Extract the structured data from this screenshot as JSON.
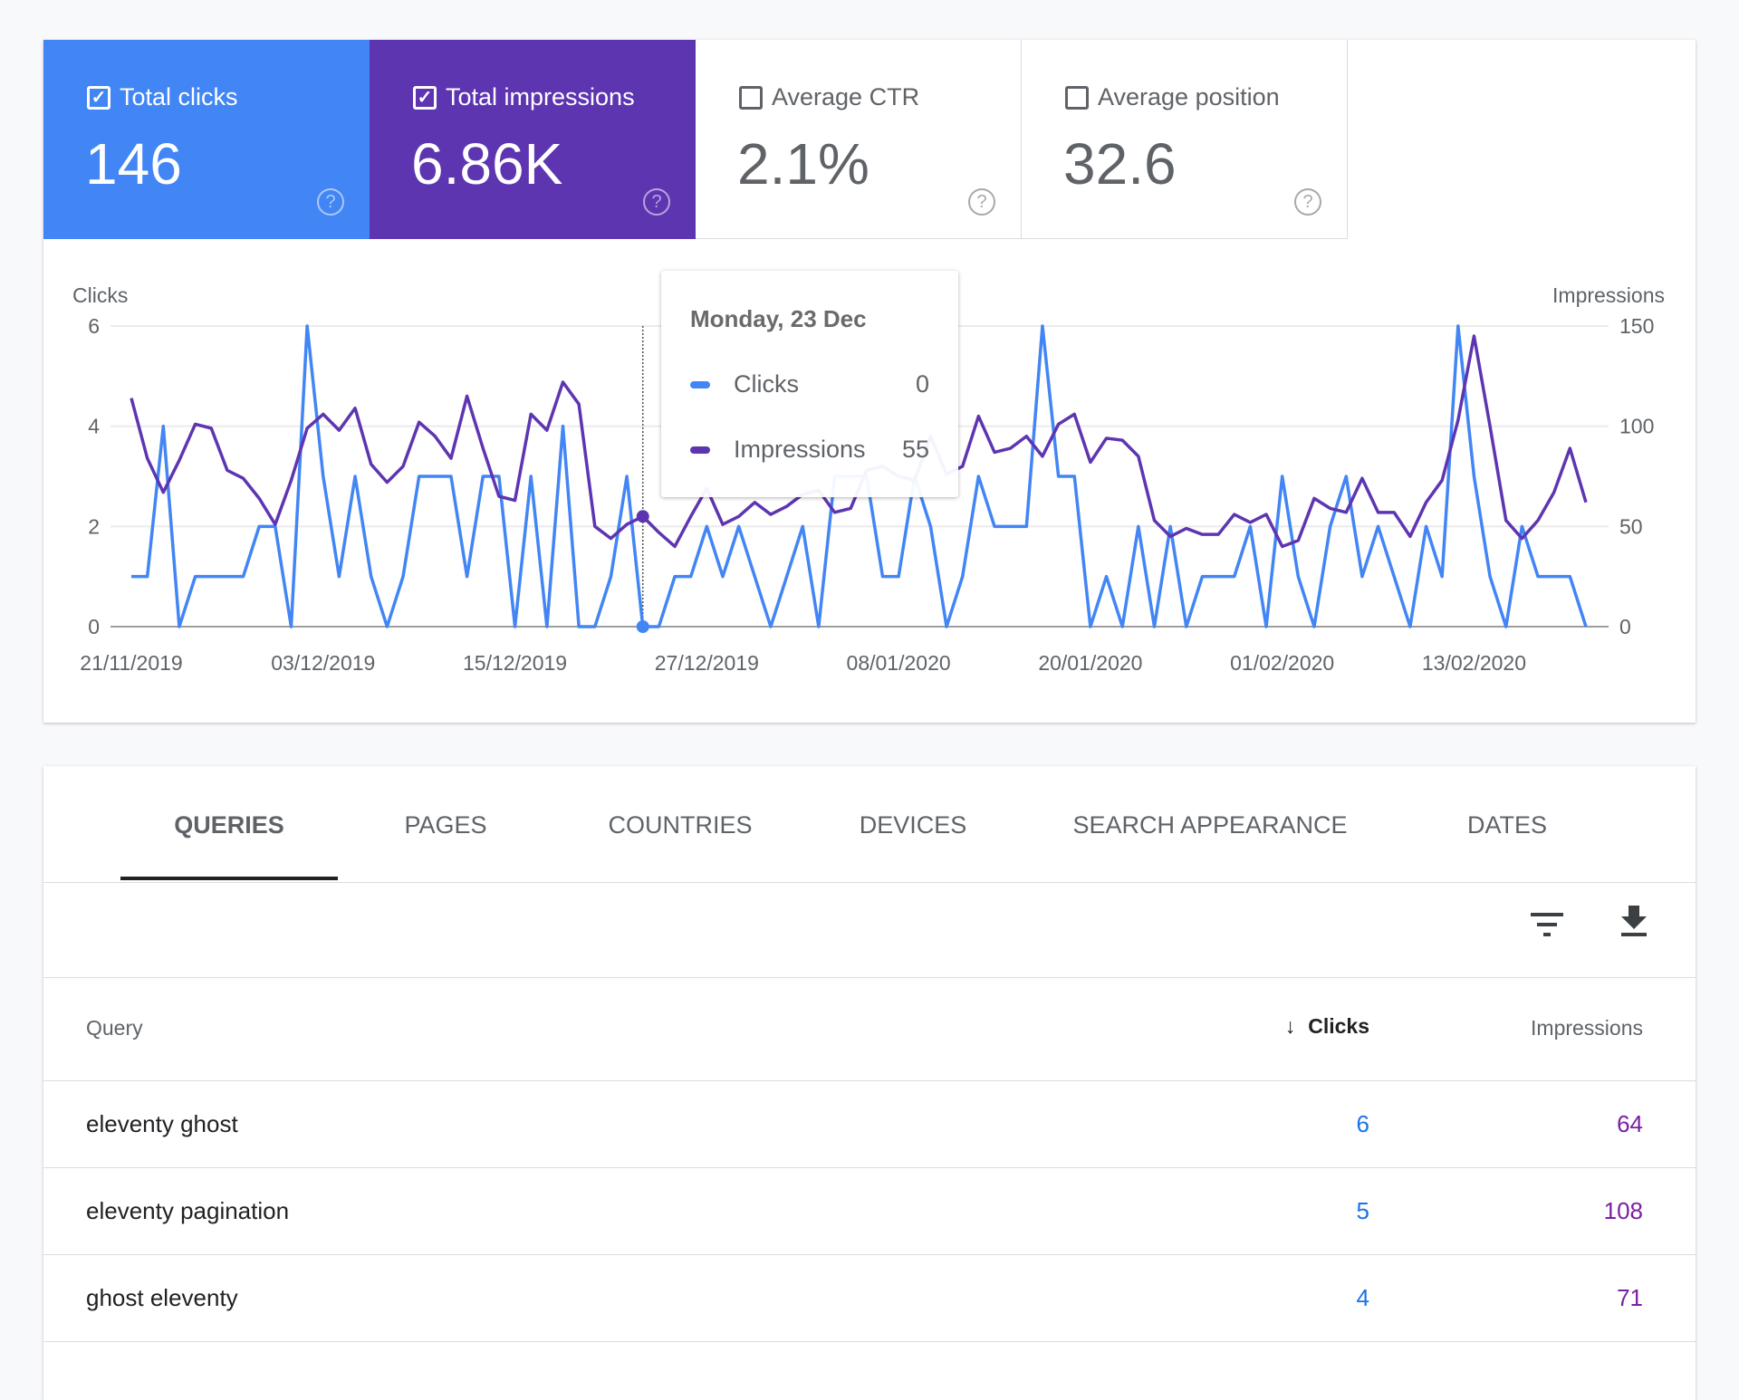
{
  "colors": {
    "clicks": "#4285f4",
    "impressions": "#5e35b1"
  },
  "kpis": [
    {
      "label": "Total clicks",
      "value": "146",
      "checked": true,
      "help_icon": "help-circle-icon"
    },
    {
      "label": "Total impressions",
      "value": "6.86K",
      "checked": true,
      "help_icon": "help-circle-icon"
    },
    {
      "label": "Average CTR",
      "value": "2.1%",
      "checked": false,
      "help_icon": "help-circle-icon"
    },
    {
      "label": "Average position",
      "value": "32.6",
      "checked": false,
      "help_icon": "help-circle-icon"
    }
  ],
  "tooltip": {
    "date": "Monday, 23 Dec",
    "rows": [
      {
        "label": "Clicks",
        "value": "0"
      },
      {
        "label": "Impressions",
        "value": "55"
      }
    ]
  },
  "chart_data": {
    "type": "line",
    "left_axis_label": "Clicks",
    "right_axis_label": "Impressions",
    "left_ylim": [
      0,
      6
    ],
    "right_ylim": [
      0,
      150
    ],
    "left_ticks": [
      "0",
      "2",
      "4",
      "6"
    ],
    "right_ticks": [
      "0",
      "50",
      "100",
      "150"
    ],
    "x_start": "21/11/2019",
    "x_end": "20/02/2020",
    "x_ticks": [
      "21/11/2019",
      "03/12/2019",
      "15/12/2019",
      "27/12/2019",
      "08/01/2020",
      "20/01/2020",
      "01/02/2020",
      "13/02/2020"
    ],
    "grid": true,
    "highlighted": "23/12/2019",
    "series": [
      {
        "name": "Clicks",
        "axis": "left",
        "values": [
          1,
          1,
          4,
          0,
          1,
          1,
          1,
          1,
          2,
          2,
          0,
          6,
          3,
          1,
          3,
          1,
          0,
          1,
          3,
          3,
          3,
          1,
          3,
          3,
          0,
          3,
          0,
          4,
          0,
          0,
          1,
          3,
          0,
          0,
          1,
          1,
          2,
          1,
          2,
          1,
          0,
          1,
          2,
          0,
          3,
          3,
          3,
          1,
          1,
          3,
          2,
          0,
          1,
          3,
          2,
          2,
          2,
          6,
          3,
          3,
          0,
          1,
          0,
          2,
          0,
          2,
          0,
          1,
          1,
          1,
          2,
          0,
          3,
          1,
          0,
          2,
          3,
          1,
          2,
          1,
          0,
          2,
          1,
          6,
          3,
          1,
          0,
          2,
          1,
          1,
          1,
          0
        ]
      },
      {
        "name": "Impressions",
        "axis": "right",
        "values": [
          114,
          84,
          67,
          83,
          101,
          99,
          78,
          74,
          64,
          51,
          73,
          99,
          106,
          98,
          109,
          81,
          72,
          80,
          102,
          95,
          84,
          115,
          89,
          65,
          63,
          106,
          98,
          122,
          111,
          50,
          44,
          51,
          55,
          47,
          40,
          55,
          69,
          51,
          55,
          62,
          56,
          60,
          66,
          68,
          57,
          59,
          78,
          80,
          75,
          73,
          95,
          76,
          80,
          105,
          87,
          89,
          95,
          85,
          101,
          106,
          82,
          94,
          93,
          85,
          53,
          45,
          49,
          46,
          46,
          56,
          52,
          56,
          40,
          43,
          64,
          59,
          57,
          74,
          57,
          57,
          45,
          62,
          73,
          103,
          145,
          100,
          53,
          44,
          53,
          67,
          89,
          62
        ]
      }
    ]
  },
  "tabs": [
    {
      "label": "QUERIES",
      "active": true
    },
    {
      "label": "PAGES"
    },
    {
      "label": "COUNTRIES"
    },
    {
      "label": "DEVICES"
    },
    {
      "label": "SEARCH APPEARANCE"
    },
    {
      "label": "DATES"
    }
  ],
  "toolbar": {
    "filter_icon": "filter-icon",
    "download_icon": "download-icon"
  },
  "table": {
    "headers": {
      "query": "Query",
      "clicks": "Clicks",
      "impressions": "Impressions",
      "sort": "arrow-down-icon"
    },
    "rows": [
      {
        "query": "eleventy ghost",
        "clicks": "6",
        "impressions": "64"
      },
      {
        "query": "eleventy pagination",
        "clicks": "5",
        "impressions": "108"
      },
      {
        "query": "ghost eleventy",
        "clicks": "4",
        "impressions": "71"
      }
    ]
  }
}
